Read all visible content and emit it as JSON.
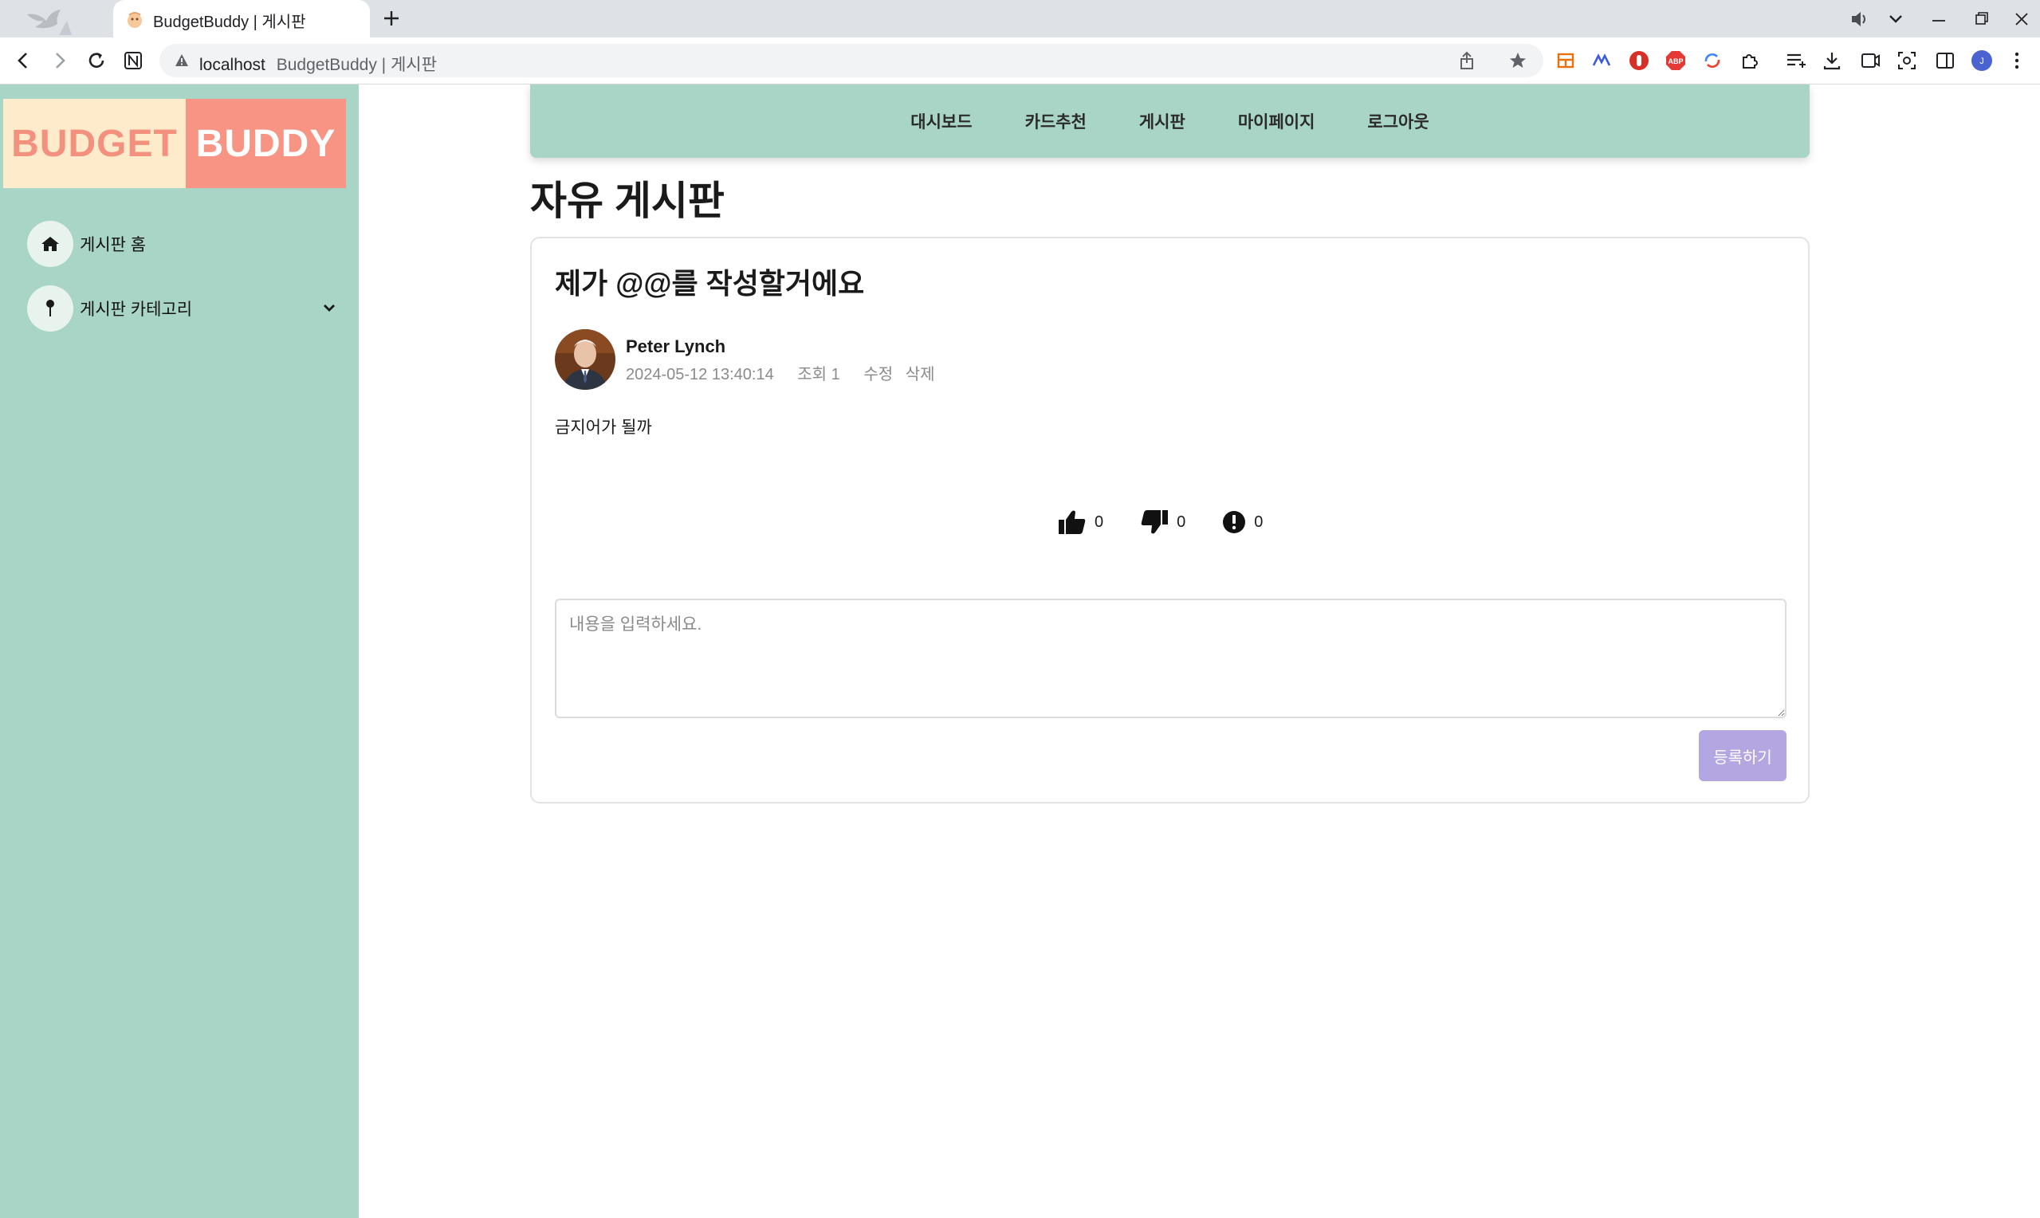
{
  "browser": {
    "tab_title": "BudgetBuddy | 게시판",
    "url_host": "localhost",
    "url_rest": "BudgetBuddy | 게시판"
  },
  "logo": {
    "part1": "BUDGET",
    "part2": "BUDDY"
  },
  "sidebar": {
    "items": [
      {
        "label": "게시판 홈",
        "icon": "home-icon"
      },
      {
        "label": "게시판 카테고리",
        "icon": "pin-icon"
      }
    ]
  },
  "topnav": {
    "links": [
      "대시보드",
      "카드추천",
      "게시판",
      "마이페이지",
      "로그아웃"
    ]
  },
  "page": {
    "heading": "자유 게시판"
  },
  "post": {
    "title": "제가 @@를 작성할거에요",
    "author": "Peter Lynch",
    "date": "2024-05-12 13:40:14",
    "views": "조회 1",
    "edit_label": "수정",
    "delete_label": "삭제",
    "body": "금지어가 될까",
    "likes": "0",
    "dislikes": "0",
    "reports": "0"
  },
  "comment": {
    "placeholder": "내용을 입력하세요.",
    "submit_label": "등록하기"
  },
  "colors": {
    "mint": "#a8d5c6",
    "logo_cream": "#fdebcb",
    "logo_coral": "#f79483",
    "button_lavender": "#b4a6e0"
  }
}
